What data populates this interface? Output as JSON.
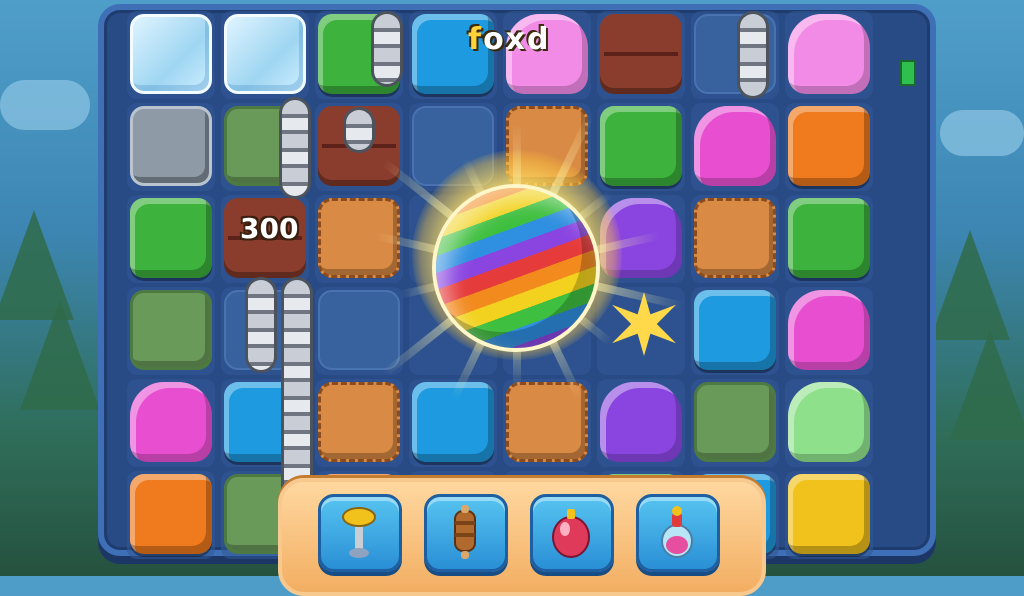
{
  "game": {
    "floating_score": "300",
    "garbled_text": "foxd",
    "garbled_accent": "f",
    "garbled_rest": "oxd"
  },
  "boosters": [
    {
      "name": "hammer-booster",
      "icon": "hammer-icon"
    },
    {
      "name": "rolling-pin-booster",
      "icon": "rolling-pin-icon"
    },
    {
      "name": "potion-booster",
      "icon": "potion-icon"
    },
    {
      "name": "bottle-booster",
      "icon": "bottle-icon"
    }
  ],
  "colors": {
    "board": "#284b86",
    "tray": "#f2ae62",
    "booster_button": "#2a8fd6"
  }
}
